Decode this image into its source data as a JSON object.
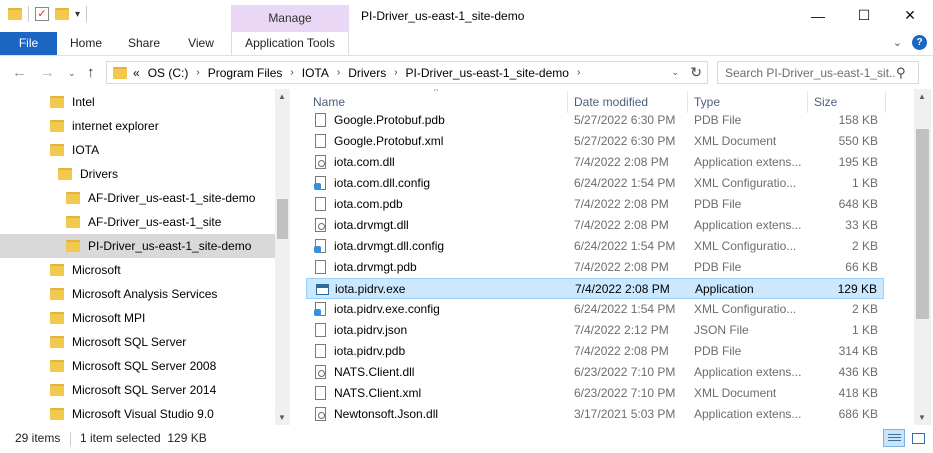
{
  "window": {
    "title": "PI-Driver_us-east-1_site-demo",
    "contextual_tab_group": "Manage",
    "controls": {
      "minimize": "—",
      "maximize": "☐",
      "close": "✕"
    }
  },
  "ribbon": {
    "tabs": [
      "File",
      "Home",
      "Share",
      "View",
      "Application Tools"
    ]
  },
  "address_bar": {
    "overflow": "«",
    "breadcrumbs": [
      "OS (C:)",
      "Program Files",
      "IOTA",
      "Drivers",
      "PI-Driver_us-east-1_site-demo"
    ],
    "search_placeholder": "Search PI-Driver_us-east-1_sit..."
  },
  "nav_tree": [
    {
      "label": "Intel",
      "indent": 0
    },
    {
      "label": "internet explorer",
      "indent": 0
    },
    {
      "label": "IOTA",
      "indent": 0
    },
    {
      "label": "Drivers",
      "indent": 1
    },
    {
      "label": "AF-Driver_us-east-1_site-demo",
      "indent": 2
    },
    {
      "label": "AF-Driver_us-east-1_site",
      "indent": 2
    },
    {
      "label": "PI-Driver_us-east-1_site-demo",
      "indent": 2,
      "selected": true
    },
    {
      "label": "Microsoft",
      "indent": 0
    },
    {
      "label": "Microsoft Analysis Services",
      "indent": 0
    },
    {
      "label": "Microsoft MPI",
      "indent": 0
    },
    {
      "label": "Microsoft SQL Server",
      "indent": 0
    },
    {
      "label": "Microsoft SQL Server 2008",
      "indent": 0
    },
    {
      "label": "Microsoft SQL Server 2014",
      "indent": 0
    },
    {
      "label": "Microsoft Visual Studio 9.0",
      "indent": 0
    }
  ],
  "columns": {
    "name": "Name",
    "date": "Date modified",
    "type": "Type",
    "size": "Size"
  },
  "files": [
    {
      "name": "Google.Protobuf.pdb",
      "date": "5/27/2022 6:30 PM",
      "type": "PDB File",
      "size": "158 KB",
      "icon": "blank"
    },
    {
      "name": "Google.Protobuf.xml",
      "date": "5/27/2022 6:30 PM",
      "type": "XML Document",
      "size": "550 KB",
      "icon": "blank"
    },
    {
      "name": "iota.com.dll",
      "date": "7/4/2022 2:08 PM",
      "type": "Application extens...",
      "size": "195 KB",
      "icon": "gear"
    },
    {
      "name": "iota.com.dll.config",
      "date": "6/24/2022 1:54 PM",
      "type": "XML Configuratio...",
      "size": "1 KB",
      "icon": "cfg"
    },
    {
      "name": "iota.com.pdb",
      "date": "7/4/2022 2:08 PM",
      "type": "PDB File",
      "size": "648 KB",
      "icon": "blank"
    },
    {
      "name": "iota.drvmgt.dll",
      "date": "7/4/2022 2:08 PM",
      "type": "Application extens...",
      "size": "33 KB",
      "icon": "gear"
    },
    {
      "name": "iota.drvmgt.dll.config",
      "date": "6/24/2022 1:54 PM",
      "type": "XML Configuratio...",
      "size": "2 KB",
      "icon": "cfg"
    },
    {
      "name": "iota.drvmgt.pdb",
      "date": "7/4/2022 2:08 PM",
      "type": "PDB File",
      "size": "66 KB",
      "icon": "blank"
    },
    {
      "name": "iota.pidrv.exe",
      "date": "7/4/2022 2:08 PM",
      "type": "Application",
      "size": "129 KB",
      "icon": "app",
      "selected": true
    },
    {
      "name": "iota.pidrv.exe.config",
      "date": "6/24/2022 1:54 PM",
      "type": "XML Configuratio...",
      "size": "2 KB",
      "icon": "cfg"
    },
    {
      "name": "iota.pidrv.json",
      "date": "7/4/2022 2:12 PM",
      "type": "JSON File",
      "size": "1 KB",
      "icon": "blank"
    },
    {
      "name": "iota.pidrv.pdb",
      "date": "7/4/2022 2:08 PM",
      "type": "PDB File",
      "size": "314 KB",
      "icon": "blank"
    },
    {
      "name": "NATS.Client.dll",
      "date": "6/23/2022 7:10 PM",
      "type": "Application extens...",
      "size": "436 KB",
      "icon": "gear"
    },
    {
      "name": "NATS.Client.xml",
      "date": "6/23/2022 7:10 PM",
      "type": "XML Document",
      "size": "418 KB",
      "icon": "blank"
    },
    {
      "name": "Newtonsoft.Json.dll",
      "date": "3/17/2021 5:03 PM",
      "type": "Application extens...",
      "size": "686 KB",
      "icon": "gear"
    }
  ],
  "status": {
    "item_count": "29 items",
    "selection": "1 item selected  129 KB"
  },
  "colors": {
    "file_tab": "#1a66c2",
    "manage_tab": "#e9d7f5",
    "selection": "#cce8ff",
    "folder": "#f2c94c"
  }
}
